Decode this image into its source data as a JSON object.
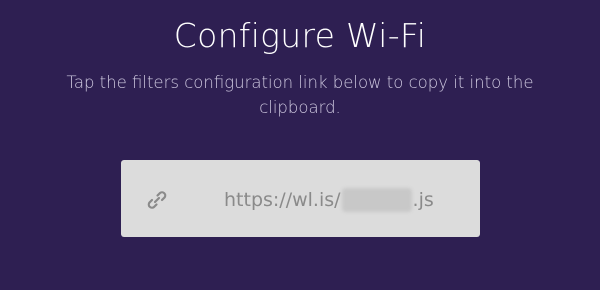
{
  "header": {
    "title": "Configure Wi-Fi",
    "instructions": "Tap the filters configuration link below to copy it into the clipboard."
  },
  "link": {
    "prefix": "https://wl.is/",
    "suffix": ".js",
    "icon": "link-icon"
  },
  "colors": {
    "background": "#2e1f52",
    "card": "#dcdcdc",
    "link_text": "#8a8a8a"
  }
}
